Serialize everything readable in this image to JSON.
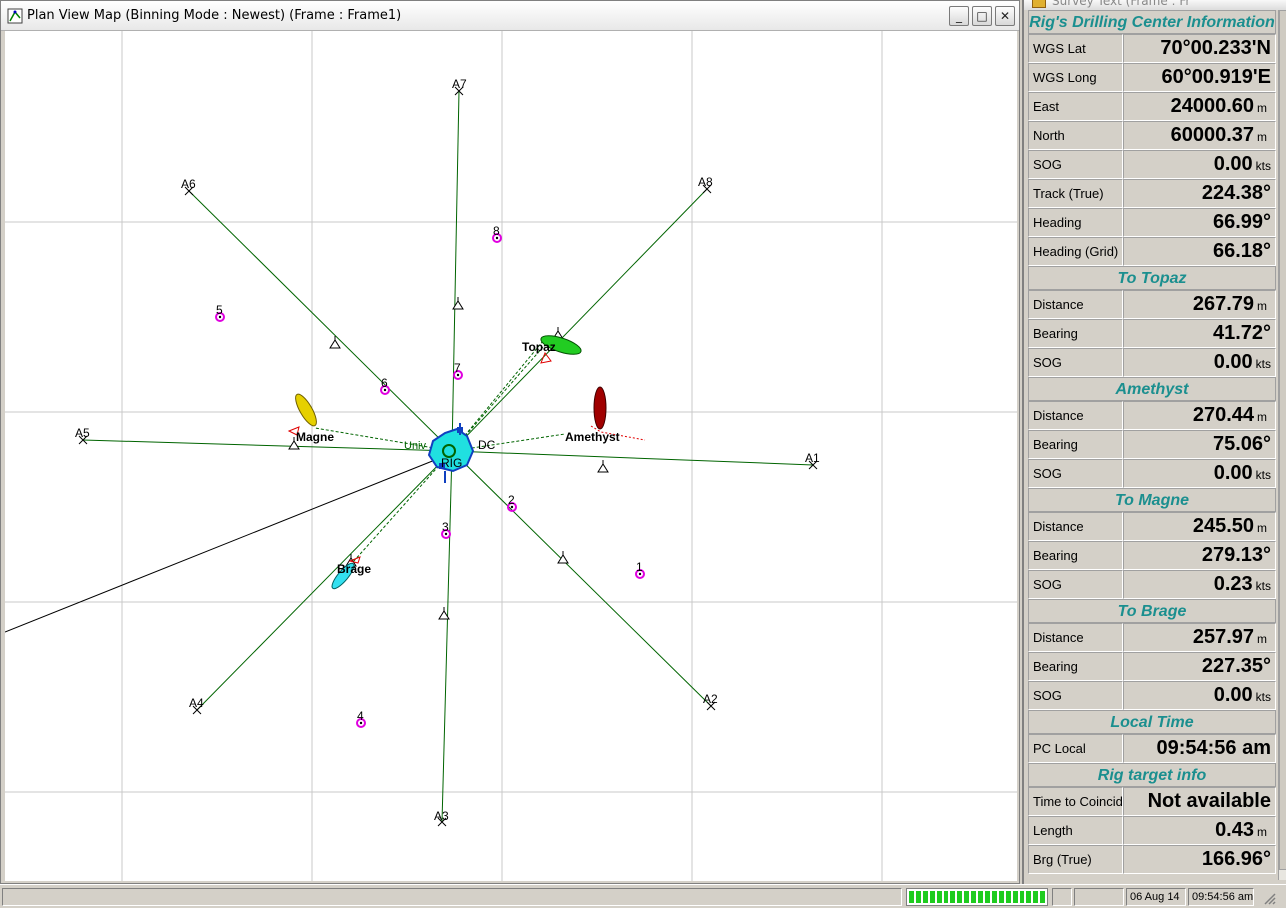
{
  "map_window": {
    "title": "Plan View Map (Binning Mode : Newest)  (Frame : Frame1)",
    "buttons": {
      "minimize": "_",
      "maximize": "□",
      "close": "✕"
    }
  },
  "map": {
    "anchors": [
      {
        "id": "A1",
        "label": "A1"
      },
      {
        "id": "A2",
        "label": "A2"
      },
      {
        "id": "A3",
        "label": "A3"
      },
      {
        "id": "A4",
        "label": "A4"
      },
      {
        "id": "A5",
        "label": "A5"
      },
      {
        "id": "A6",
        "label": "A6"
      },
      {
        "id": "A7",
        "label": "A7"
      },
      {
        "id": "A8",
        "label": "A8"
      }
    ],
    "targets": [
      {
        "label": "1"
      },
      {
        "label": "2"
      },
      {
        "label": "3"
      },
      {
        "label": "4"
      },
      {
        "label": "5"
      },
      {
        "label": "6"
      },
      {
        "label": "7"
      },
      {
        "label": "8"
      }
    ],
    "vessels": {
      "topaz": "Topaz",
      "amethyst": "Amethyst",
      "magne": "Magne",
      "brage": "Brage",
      "rig": "RIG"
    },
    "rig_annotations": {
      "univ": "Univ",
      "dc": "DC"
    },
    "colors": {
      "mooring_line": "#006400",
      "target_marker": "#e000e0",
      "topaz": "#22cc22",
      "amethyst": "#a00000",
      "magne": "#e6d000",
      "brage": "#33e0f0",
      "rig": "#2288ff",
      "heading_marker": "#e00000"
    }
  },
  "info_panel": {
    "window_title": "Survey Text (Frame : Fr",
    "sections": [
      {
        "title": "Rig's Drilling Center Information",
        "rows": [
          {
            "label": "WGS Lat",
            "value": "70°00.233'N",
            "unit": ""
          },
          {
            "label": "WGS Long",
            "value": "60°00.919'E",
            "unit": ""
          },
          {
            "label": "East",
            "value": "24000.60",
            "unit": "m"
          },
          {
            "label": "North",
            "value": "60000.37",
            "unit": "m"
          },
          {
            "label": "SOG",
            "value": "0.00",
            "unit": "kts"
          },
          {
            "label": "Track (True)",
            "value": "224.38°",
            "unit": ""
          },
          {
            "label": "Heading",
            "value": "66.99°",
            "unit": ""
          },
          {
            "label": "Heading (Grid)",
            "value": "66.18°",
            "unit": ""
          }
        ]
      },
      {
        "title": "To Topaz",
        "rows": [
          {
            "label": "Distance",
            "value": "267.79",
            "unit": "m"
          },
          {
            "label": "Bearing",
            "value": "41.72°",
            "unit": ""
          },
          {
            "label": "SOG",
            "value": "0.00",
            "unit": "kts"
          }
        ]
      },
      {
        "title": "Amethyst",
        "rows": [
          {
            "label": "Distance",
            "value": "270.44",
            "unit": "m"
          },
          {
            "label": "Bearing",
            "value": "75.06°",
            "unit": ""
          },
          {
            "label": "SOG",
            "value": "0.00",
            "unit": "kts"
          }
        ]
      },
      {
        "title": "To Magne",
        "rows": [
          {
            "label": "Distance",
            "value": "245.50",
            "unit": "m"
          },
          {
            "label": "Bearing",
            "value": "279.13°",
            "unit": ""
          },
          {
            "label": "SOG",
            "value": "0.23",
            "unit": "kts"
          }
        ]
      },
      {
        "title": "To Brage",
        "rows": [
          {
            "label": "Distance",
            "value": "257.97",
            "unit": "m"
          },
          {
            "label": "Bearing",
            "value": "227.35°",
            "unit": ""
          },
          {
            "label": "SOG",
            "value": "0.00",
            "unit": "kts"
          }
        ]
      },
      {
        "title": "Local Time",
        "rows": [
          {
            "label": "PC Local",
            "value": "09:54:56 am",
            "unit": ""
          }
        ]
      },
      {
        "title": "Rig target info",
        "rows": [
          {
            "label": "Time to Coincid",
            "value": "Not available",
            "unit": ""
          },
          {
            "label": "Length",
            "value": "0.43",
            "unit": "m"
          },
          {
            "label": "Brg (True)",
            "value": "166.96°",
            "unit": ""
          }
        ]
      }
    ]
  },
  "status_bar": {
    "date": "06 Aug 14",
    "time": "09:54:56 am",
    "progress_blocks": 20
  }
}
